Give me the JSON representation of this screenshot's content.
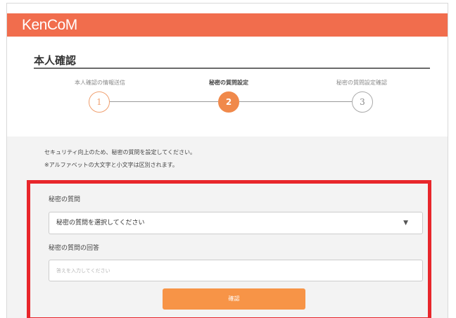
{
  "app": {
    "logo_text": "KenCoM",
    "brand_color": "#f16d4d"
  },
  "page": {
    "title": "本人確認"
  },
  "steps": [
    {
      "number": "1",
      "label": "本人確認の情報送信",
      "state": "done"
    },
    {
      "number": "2",
      "label": "秘密の質問設定",
      "state": "active"
    },
    {
      "number": "3",
      "label": "秘密の質問設定確認",
      "state": "pending"
    }
  ],
  "description": {
    "line1": "セキュリティ向上のため、秘密の質問を設定してください。",
    "line2": "※アルファベットの大文字と小文字は区別されます。"
  },
  "form": {
    "question_label": "秘密の質問",
    "question_selected": "秘密の質問を選択してください",
    "answer_label": "秘密の質問の回答",
    "answer_placeholder": "答えを入力してください",
    "confirm_label": "確認",
    "highlight_color": "#e8262b",
    "button_color": "#f79447"
  }
}
